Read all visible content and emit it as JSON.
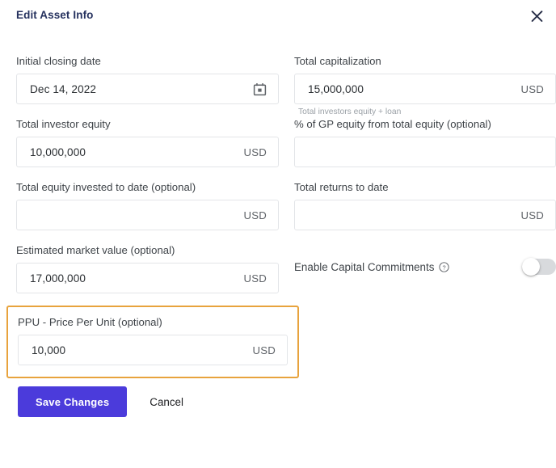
{
  "dialog": {
    "title": "Edit Asset Info",
    "close_icon": "close-icon"
  },
  "fields": {
    "initial_closing_date": {
      "label": "Initial closing date",
      "value": "Dec 14, 2022",
      "placeholder": "",
      "icon": "calendar-icon"
    },
    "total_capitalization": {
      "label": "Total capitalization",
      "value": "15,000,000",
      "placeholder": "",
      "suffix": "USD",
      "helper": "Total investors equity + loan"
    },
    "total_investor_equity": {
      "label": "Total investor equity",
      "value": "10,000,000",
      "placeholder": "",
      "suffix": "USD"
    },
    "gp_equity_percent": {
      "label": "% of GP equity from total equity (optional)",
      "value": "",
      "placeholder": "",
      "suffix": ""
    },
    "total_equity_invested": {
      "label": "Total equity invested to date (optional)",
      "value": "",
      "placeholder": "",
      "suffix": "USD"
    },
    "total_returns_to_date": {
      "label": "Total returns to date",
      "value": "",
      "placeholder": "",
      "suffix": "USD"
    },
    "estimated_market_value": {
      "label": "Estimated market value (optional)",
      "value": "17,000,000",
      "placeholder": "",
      "suffix": "USD"
    },
    "price_per_unit": {
      "label": "PPU - Price Per Unit (optional)",
      "value": "10,000",
      "placeholder": "",
      "suffix": "USD"
    }
  },
  "capital_commitments": {
    "label": "Enable Capital Commitments",
    "help_icon": "help-circle-icon",
    "enabled": false
  },
  "actions": {
    "save_label": "Save Changes",
    "cancel_label": "Cancel"
  },
  "colors": {
    "primary_button": "#4b3bdb",
    "title": "#25315e",
    "highlight_border": "#e8a33d",
    "input_border": "#e3e5e8",
    "toggle_track_off": "#d8dadd"
  }
}
